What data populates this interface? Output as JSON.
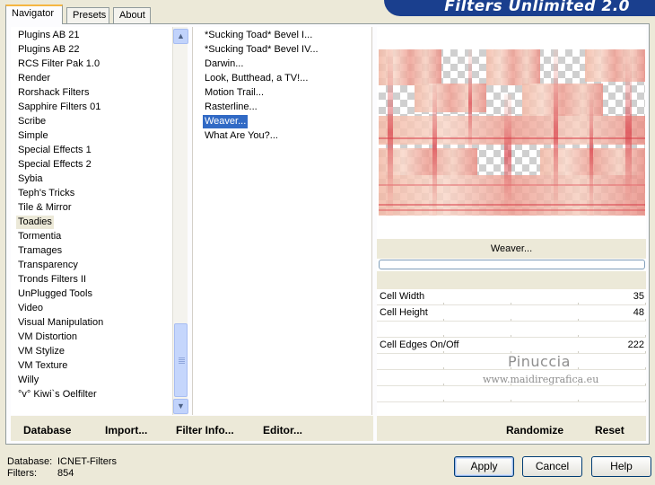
{
  "app": {
    "title": "Filters Unlimited 2.0"
  },
  "tabs": [
    {
      "label": "Navigator",
      "active": true
    },
    {
      "label": "Presets",
      "active": false
    },
    {
      "label": "About",
      "active": false
    }
  ],
  "categories": [
    "Plugins AB 21",
    "Plugins AB 22",
    "RCS Filter Pak 1.0",
    "Render",
    "Rorshack Filters",
    "Sapphire Filters 01",
    "Scribe",
    "Simple",
    "Special Effects 1",
    "Special Effects 2",
    "Sybia",
    "Teph's Tricks",
    "Tile & Mirror",
    "Toadies",
    "Tormentia",
    "Tramages",
    "Transparency",
    "Tronds Filters II",
    "UnPlugged Tools",
    "Video",
    "Visual Manipulation",
    "VM Distortion",
    "VM Stylize",
    "VM Texture",
    "Willy",
    "°v° Kiwi`s Oelfilter"
  ],
  "highlighted_category": "Toadies",
  "filters": [
    "*Sucking Toad*  Bevel I...",
    "*Sucking Toad*  Bevel IV...",
    "Darwin...",
    "Look, Butthead, a TV!...",
    "Motion Trail...",
    "Rasterline...",
    "Weaver...",
    "What Are You?..."
  ],
  "selected_filter": "Weaver...",
  "preview": {
    "filter_name": "Weaver...",
    "progress": 0
  },
  "params": [
    {
      "label": "Cell Width",
      "value": "35"
    },
    {
      "label": "Cell Height",
      "value": "48"
    },
    {
      "label": "Cell Edges On/Off",
      "value": "222"
    }
  ],
  "watermark": {
    "line1": "Pinuccia",
    "line2": "www.maidiregrafica.eu"
  },
  "toolbar": {
    "database": "Database",
    "import": "Import...",
    "filter_info": "Filter Info...",
    "editor": "Editor...",
    "randomize": "Randomize",
    "reset": "Reset"
  },
  "status": {
    "database_label": "Database:",
    "database_value": "ICNET-Filters",
    "filters_label": "Filters:",
    "filters_value": "854"
  },
  "buttons": {
    "apply": "Apply",
    "cancel": "Cancel",
    "help": "Help"
  },
  "colors": {
    "selection": "#316ac5",
    "banner": "#1a3f8e",
    "dialog_bg": "#ece9d8"
  }
}
